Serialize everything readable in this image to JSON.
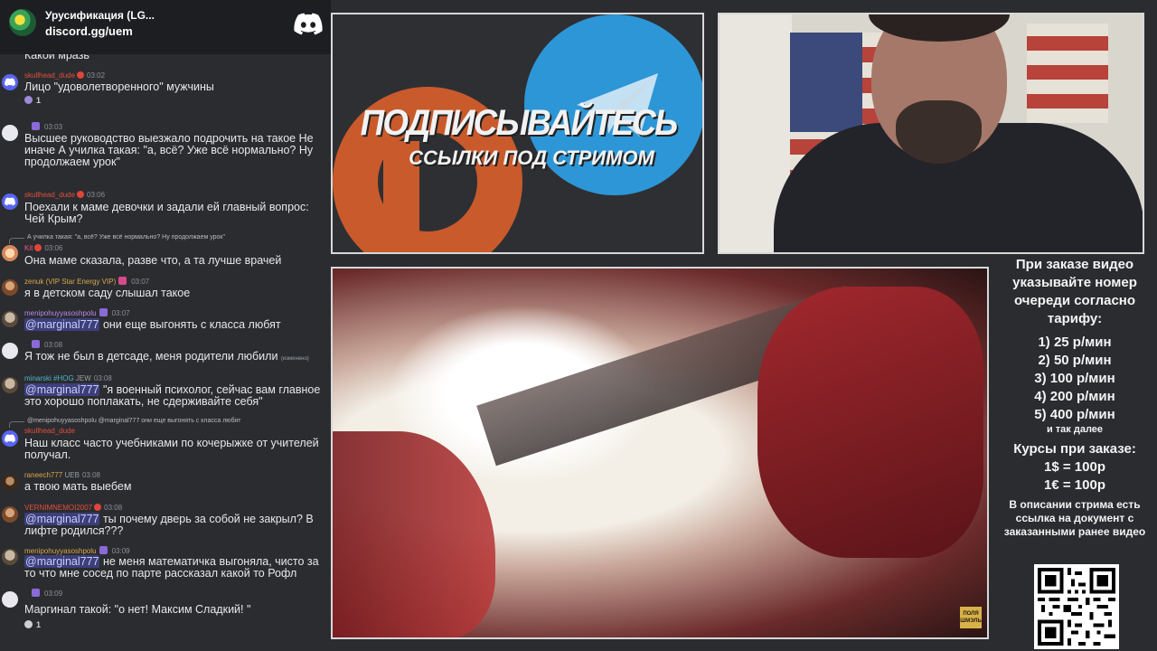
{
  "chat": {
    "server_title": "Урусификация (LG...",
    "server_link": "discord.gg/uem",
    "top_partial": "Какой мразь",
    "messages": [
      {
        "user": "skullhead_dude",
        "time": "03:02",
        "text": "Лицо \"удоволетворенного\" мужчины",
        "reaction_count": "1"
      },
      {
        "user": "",
        "time": "03:03",
        "text": "Высшее руководство выезжало подрочить на такое Не иначе А училка такая: \"а, всё? Уже всё нормально? Ну продолжаем урок\""
      },
      {
        "user": "skullhead_dude",
        "time": "03:06",
        "text": "Поехали к маме девочки и задали ей главный вопрос: Чей Крым?"
      },
      {
        "reply": "А училка такая: \"а, всё? Уже всё нормально? Ну продолжаем урок\"",
        "user": "Kit",
        "time": "03:06",
        "text": "Она маме сказала, разве что, а та лучше врачей"
      },
      {
        "user": "zenuk (VIP Star Energy VIP)",
        "time": "03:07",
        "text": "я в детском саду слышал такое"
      },
      {
        "user": "menipohuyyasoshpolu",
        "time": "03:07",
        "mention": "@marginal777",
        "text": " они еще выгонять с класса любят"
      },
      {
        "user": "",
        "time": "03:08",
        "text": "Я тож не был в детсаде, меня родители любили",
        "edited": "(изменено)"
      },
      {
        "user": "minarski #HOG",
        "tag": "JEW",
        "time": "03:08",
        "mention": "@marginal777",
        "text": " \"я военный психолог, сейчас вам главное это хорошо поплакать, не сдерживайте себя\""
      },
      {
        "reply": "@menipohuyyasoshpolu @marginal777 они еще выгонять с класса любят",
        "user": "skullhead_dude",
        "time": "",
        "text": "Наш класс часто учебниками по кочерыжке от учителей получал."
      },
      {
        "user": "raneech777",
        "tag": "UEB",
        "time": "03:08",
        "text": "а твою мать выебем"
      },
      {
        "user": "VERNIMNEMOI2007",
        "time": "03:08",
        "mention": "@marginal777",
        "text": " ты почему дверь за собой не закрыл? В лифте родился???"
      },
      {
        "user": "menipohuyyasoshpolu",
        "time": "03:09",
        "mention": "@marginal777",
        "text": " не меня математичка выгоняла, чисто за то что мне сосед по парте  рассказал какой то Рофл"
      },
      {
        "user": "",
        "time": "03:09",
        "text": "Маргинал такой: \"о нет! Максим Сладкий! \"",
        "reaction_count": "1"
      }
    ]
  },
  "promo": {
    "line1": "ПОДПИСЫВАЙТЕСЬ",
    "line2": "ССЫЛКИ ПОД СТРИМОМ"
  },
  "video": {
    "logo_text": "ПОЛЯ ШМЭЛЬ"
  },
  "info": {
    "heading": "При заказе видео указывайте номер очереди согласно тарифу:",
    "tiers": [
      "1) 25 р/мин",
      "2) 50 р/мин",
      "3) 100 р/мин",
      "4) 200 р/мин",
      "5) 400 р/мин"
    ],
    "etc": "и так далее",
    "rates_title": "Курсы при заказе:",
    "rate1": "1$ = 100р",
    "rate2": "1€ = 100р",
    "desc": "В описании стрима есть ссылка на документ с заказанными ранее видео"
  },
  "colors": {
    "background": "#2b2c30",
    "discord_blurple": "#5865f2",
    "mention_bg": "#3c3f7a",
    "telegram_blue": "#2d96d6",
    "patreon_orange": "#c95a2c"
  }
}
